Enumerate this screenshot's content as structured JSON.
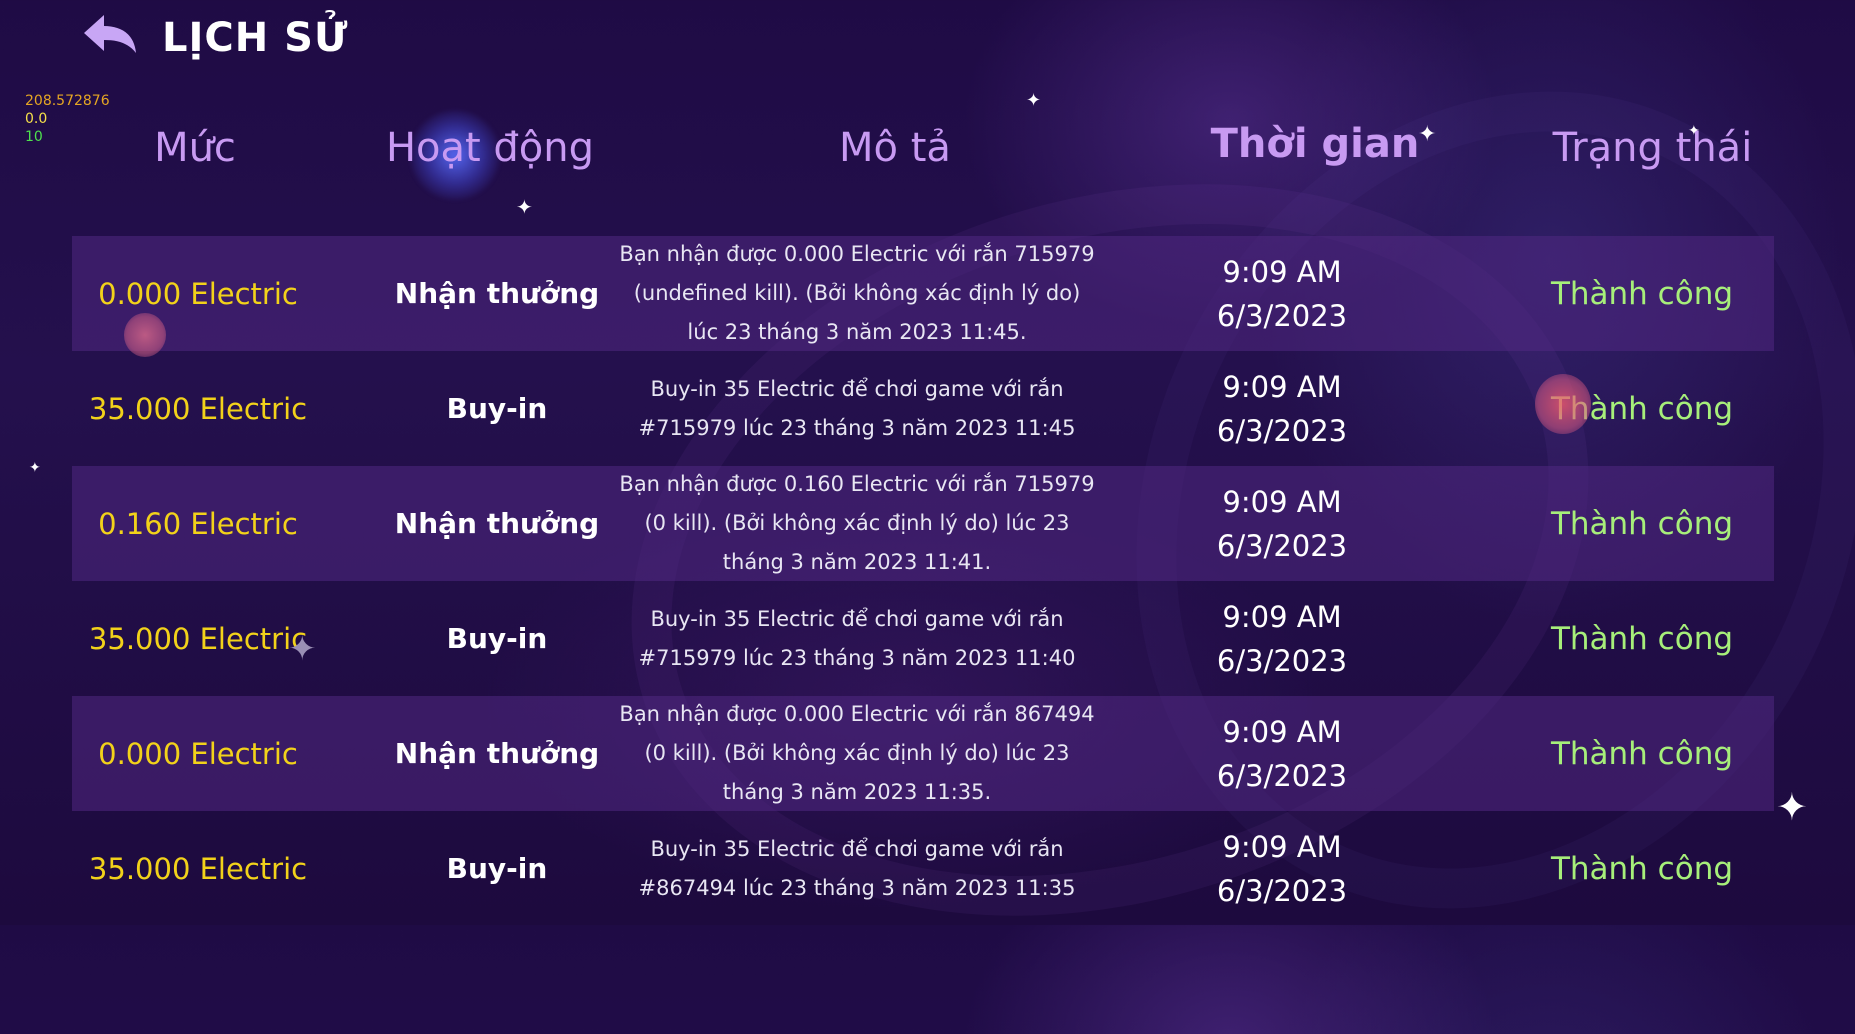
{
  "header": {
    "title": "LỊCH SỬ",
    "back_icon": "back-arrow-icon"
  },
  "debug": {
    "line1": "208.572876",
    "line2": "0.0",
    "line3": "10"
  },
  "columns": {
    "amount": "Mức",
    "activity": "Hoạt động",
    "description": "Mô tả",
    "time": "Thời gian",
    "status": "Trạng thái"
  },
  "rows": [
    {
      "amount": "0.000 Electric",
      "activity": "Nhận thưởng",
      "description": "Bạn nhận được 0.000 Electric với rắn 715979 (undefined kill). (Bởi không xác định lý do) lúc 23 tháng 3 năm 2023 11:45.",
      "time": "9:09 AM",
      "date": "6/3/2023",
      "status": "Thành công"
    },
    {
      "amount": "35.000 Electric",
      "activity": "Buy-in",
      "description": "Buy-in 35 Electric để chơi game với rắn #715979 lúc 23 tháng 3 năm 2023 11:45",
      "time": "9:09 AM",
      "date": "6/3/2023",
      "status": "Thành công"
    },
    {
      "amount": "0.160 Electric",
      "activity": "Nhận thưởng",
      "description": "Bạn nhận được 0.160 Electric với rắn 715979 (0 kill). (Bởi không xác định lý do) lúc 23 tháng 3 năm 2023 11:41.",
      "time": "9:09 AM",
      "date": "6/3/2023",
      "status": "Thành công"
    },
    {
      "amount": "35.000 Electric",
      "activity": "Buy-in",
      "description": "Buy-in 35 Electric để chơi game với rắn #715979 lúc 23 tháng 3 năm 2023 11:40",
      "time": "9:09 AM",
      "date": "6/3/2023",
      "status": "Thành công"
    },
    {
      "amount": "0.000 Electric",
      "activity": "Nhận thưởng",
      "description": "Bạn nhận được 0.000 Electric với rắn 867494 (0 kill). (Bởi không xác định lý do) lúc 23 tháng 3 năm 2023 11:35.",
      "time": "9:09 AM",
      "date": "6/3/2023",
      "status": "Thành công"
    },
    {
      "amount": "35.000 Electric",
      "activity": "Buy-in",
      "description": "Buy-in 35 Electric để chơi game với rắn #867494 lúc 23 tháng 3 năm 2023 11:35",
      "time": "9:09 AM",
      "date": "6/3/2023",
      "status": "Thành công"
    }
  ],
  "colors": {
    "header_text": "#c89af2",
    "amount": "#f2d21a",
    "status_success": "#a7ef7a",
    "background": "#22104a",
    "row_shade": "#3c1e6a"
  }
}
